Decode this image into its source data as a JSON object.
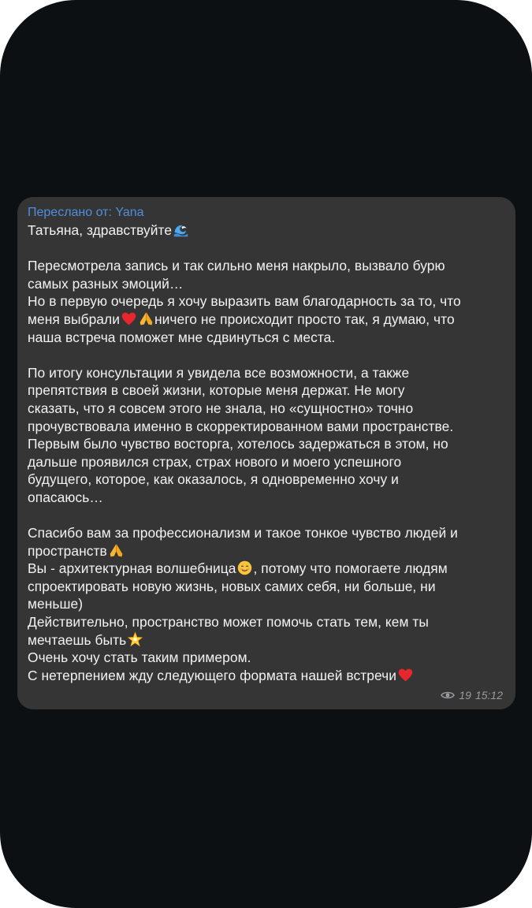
{
  "message": {
    "forward_prefix": "Переслано от: ",
    "forward_from": "Yana",
    "greeting": "Татьяна, здравствуйте",
    "p1_l1": "Пересмотрела запись и так сильно меня накрыло, вызвало бурю",
    "p1_l2": "самых разных эмоций…",
    "p1_l3": "Но в первую очередь я хочу выразить вам благодарность за то, что",
    "p1_l4_a": "меня выбрали",
    "p1_l4_b": "ничего не происходит просто так, я думаю, что",
    "p1_l5": "наша встреча поможет мне сдвинуться с места.",
    "p2_l1": "По итогу консультации я увидела все возможности, а также",
    "p2_l2": "препятствия в своей жизни, которые меня держат. Не могу",
    "p2_l3": "сказать, что я совсем этого не знала, но «сущностно» точно",
    "p2_l4": "прочувствовала именно в скорректированном вами пространстве.",
    "p2_l5": "Первым было чувство восторга, хотелось задержаться в этом, но",
    "p2_l6": "дальше проявился страх, страх нового и моего успешного",
    "p2_l7": "будущего, которое, как оказалось, я одновременно хочу и",
    "p2_l8": "опасаюсь…",
    "p3_l1": "Спасибо вам за профессионализм и такое тонкое чувство людей и",
    "p3_l2": "пространств",
    "p3_l3_a": "Вы - архитектурная волшебница",
    "p3_l3_b": ", потому что помогаете людям",
    "p3_l4": "спроектировать новую жизнь, новых самих себя, ни больше, ни",
    "p3_l5": "меньше)",
    "p3_l6": "Действительно, пространство может помочь стать тем, кем ты",
    "p3_l7": "мечтаешь быть",
    "p3_l8": "Очень хочу стать таким примером.",
    "p3_l9": "С нетерпением жду следующего формата нашей встречи",
    "emojis": [
      "wave",
      "red-heart",
      "folded-hands",
      "folded-hands",
      "relieved-face",
      "glowing-star",
      "red-heart"
    ]
  },
  "meta": {
    "views": "19",
    "time": "15:12"
  },
  "colors": {
    "background": "#0d1013",
    "bubble": "#353536",
    "text": "#f2f2f2",
    "forward_accent": "#4f8fdc",
    "meta": "#9a9a9c"
  }
}
